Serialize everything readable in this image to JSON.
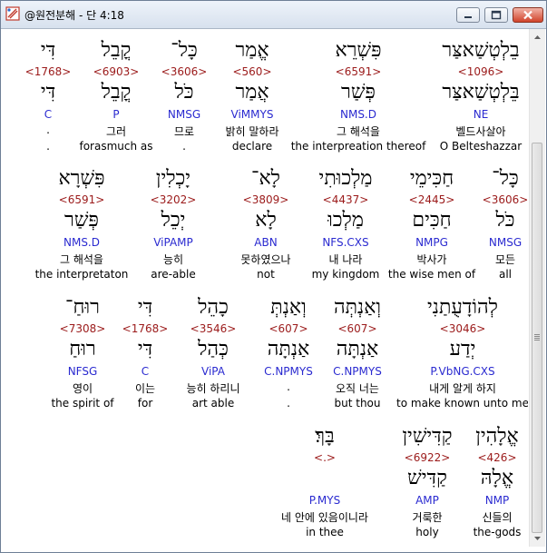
{
  "window": {
    "title": "@원전분해 - 단 4:18"
  },
  "colors": {
    "strongs": "#9b1a1a",
    "morph": "#2a2ad0"
  },
  "rows": [
    [
      {
        "heb": "דִּי",
        "num": "<1768>",
        "lemma": "דִּי",
        "morph": "C",
        "kor": ".",
        "eng": "."
      },
      {
        "heb": "קֳבֵל",
        "num": "<6903>",
        "lemma": "קֳבֵל",
        "morph": "P",
        "kor": "그러",
        "eng": "forasmuch as"
      },
      {
        "heb": "כָּל־",
        "num": "<3606>",
        "lemma": "כֹּל",
        "morph": "NMSG",
        "kor": "므로",
        "eng": "."
      },
      {
        "heb": "אֱמַר",
        "num": "<560>",
        "lemma": "אֲמַר",
        "morph": "ViMMYS",
        "kor": "밝히 말하라",
        "eng": "declare"
      },
      {
        "heb": "פִּשְׁרֵא",
        "num": "<6591>",
        "lemma": "פְּשַׁר",
        "morph": "NMS.D",
        "kor": "그 해석을",
        "eng": "the interpreation thereof"
      },
      {
        "heb": "בֵלְטְשַׁאצַּר",
        "num": "<1096>",
        "lemma": "בֵּלְטְשַׁאצַּר",
        "morph": "NE",
        "kor": "벨드사살아",
        "eng": "O Belteshazzar"
      }
    ],
    [
      {
        "heb": "פִּשְׁרָא",
        "num": "<6591>",
        "lemma": "פְּשַׁר",
        "morph": "NMS.D",
        "kor": "그 해석을",
        "eng": "the interpretaton"
      },
      {
        "heb": "יָכְלִין",
        "num": "<3202>",
        "lemma": "יְכֵל",
        "morph": "ViPAMP",
        "kor": "능히",
        "eng": "are-able"
      },
      {
        "heb": "לָא־",
        "num": "<3809>",
        "lemma": "לָא",
        "morph": "ABN",
        "kor": "못하였으나",
        "eng": "not"
      },
      {
        "heb": "מַלְכוּתִי",
        "num": "<4437>",
        "lemma": "מַלְכוּ",
        "morph": "NFS.CXS",
        "kor": "내 나라",
        "eng": "my kingdom"
      },
      {
        "heb": "חַכִּימֵי",
        "num": "<2445>",
        "lemma": "חַכִּים",
        "morph": "NMPG",
        "kor": "박사가",
        "eng": "the wise men of"
      },
      {
        "heb": "כָּל־",
        "num": "<3606>",
        "lemma": "כֹּל",
        "morph": "NMSG",
        "kor": "모든",
        "eng": "all"
      }
    ],
    [
      {
        "heb": "רוּחַ־",
        "num": "<7308>",
        "lemma": "רוּחַ",
        "morph": "NFSG",
        "kor": "영이",
        "eng": "the spirit of"
      },
      {
        "heb": "דִּי",
        "num": "<1768>",
        "lemma": "דִּי",
        "morph": "C",
        "kor": "이는",
        "eng": "for"
      },
      {
        "heb": "כָהֵל",
        "num": "<3546>",
        "lemma": "כְּהַל",
        "morph": "ViPA",
        "kor": "능히 하리니",
        "eng": "art able"
      },
      {
        "heb": "וְאַנְתְּ",
        "num": "<607>",
        "lemma": "אַנְתָּה",
        "morph": "C.NPMYS",
        "kor": ".",
        "eng": "."
      },
      {
        "heb": "וְאַנְתְּה",
        "num": "<607>",
        "lemma": "אַנְתָּה",
        "morph": "C.NPMYS",
        "kor": "오직 너는",
        "eng": "but thou"
      },
      {
        "heb": "לְהוֹדָעֻתַנִי",
        "num": "<3046>",
        "lemma": "יְדַע",
        "morph": "P.VbNG.CXS",
        "kor": "내게 알게 하지",
        "eng": "to make known unto me"
      }
    ],
    [
      {
        "heb": "בָּךְ׃",
        "num": "<.>",
        "lemma": "",
        "morph": "P.MYS",
        "kor": "네 안에 있음이니라",
        "eng": "in thee"
      },
      {
        "heb": "קַדִּישִׁין",
        "num": "<6922>",
        "lemma": "קַדִּישׁ",
        "morph": "AMP",
        "kor": "거룩한",
        "eng": "holy"
      },
      {
        "heb": "אֱלָהִין",
        "num": "<426>",
        "lemma": "אֱלָהּ",
        "morph": "NMP",
        "kor": "신들의",
        "eng": "the-gods"
      }
    ]
  ]
}
